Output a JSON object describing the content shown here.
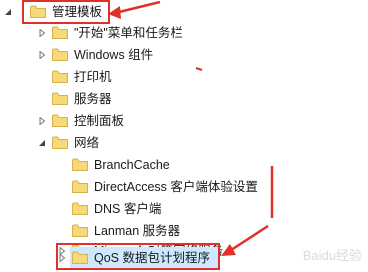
{
  "tree": {
    "root": {
      "label": "管理模板"
    },
    "items": [
      {
        "label": "\"开始\"菜单和任务栏"
      },
      {
        "label": "Windows 组件"
      },
      {
        "label": "打印机"
      },
      {
        "label": "服务器"
      },
      {
        "label": "控制面板"
      },
      {
        "label": "网络"
      }
    ],
    "network_children": [
      {
        "label": "BranchCache"
      },
      {
        "label": "DirectAccess 客户端体验设置"
      },
      {
        "label": "DNS 客户端"
      },
      {
        "label": "Lanman 服务器"
      },
      {
        "label": "Microsoft 对等网络服务"
      },
      {
        "label": "QoS 数据包计划程序"
      }
    ]
  },
  "annotations": {
    "highlight_color": "#e0302a"
  },
  "watermark": {
    "text": "Baidu经验"
  }
}
